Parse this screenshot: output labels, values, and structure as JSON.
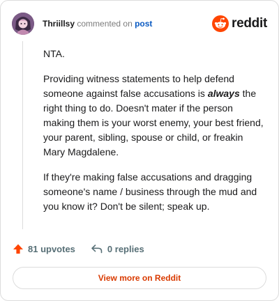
{
  "header": {
    "username": "Thriillsy",
    "action_text": "commented on",
    "post_link": "post",
    "brand": "reddit",
    "brand_color": "#FF4500",
    "avatar_icon": "user-avatar"
  },
  "comment": {
    "paragraphs": {
      "p1": "NTA.",
      "p2_before": "Providing witness statements to help defend someone against false accusations is ",
      "p2_emph": "always",
      "p2_after": " the right thing to do. Doesn't mater if the person making them is your worst enemy, your best friend, your parent, sibling, spouse or child, or freakin Mary Magdalene.",
      "p3": "If they're making false accusations and dragging someone's name / business through the mud and you know it? Don't be silent; speak up."
    }
  },
  "actions": {
    "upvotes": "81 upvotes",
    "replies": "0 replies",
    "upvote_icon": "upvote-arrow-icon",
    "reply_icon": "reply-icon",
    "upvote_color": "#FF4500"
  },
  "footer": {
    "view_more": "View more on Reddit",
    "accent_color": "#D93A00"
  }
}
